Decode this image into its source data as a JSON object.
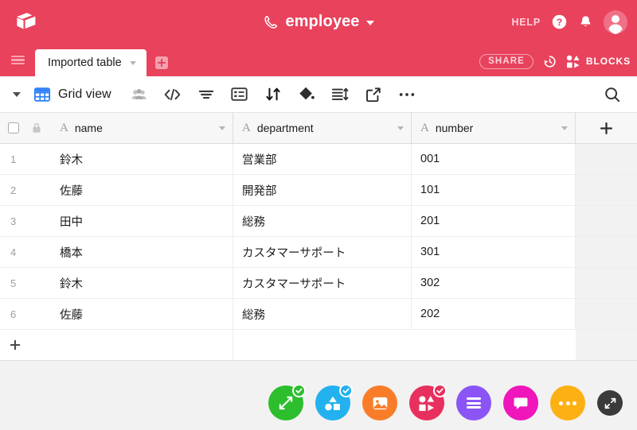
{
  "brand": {
    "logo_icon": "airtable-cube-logo",
    "bar_color": "#e8425c"
  },
  "header": {
    "base_icon": "phone-icon",
    "base_name": "employee",
    "base_caret_icon": "chevron-down-icon",
    "help_label": "HELP",
    "help_icon": "question-circle-icon",
    "notification_icon": "bell-icon",
    "avatar_icon": "user-avatar"
  },
  "tabbar": {
    "menu_icon": "hamburger-menu-icon",
    "tabs": [
      {
        "label": "Imported table",
        "caret_icon": "chevron-down-icon",
        "active": true
      }
    ],
    "add_table_icon": "plus-icon",
    "share_label": "SHARE",
    "history_icon": "history-clock-icon",
    "blocks_icon": "blocks-icon",
    "blocks_label": "BLOCKS"
  },
  "toolbar": {
    "view_caret_icon": "chevron-down-icon",
    "view_type_icon": "grid-view-icon",
    "view_name": "Grid view",
    "buttons": [
      {
        "name": "collaborators-icon",
        "label": ""
      },
      {
        "name": "hide-fields-icon",
        "label": ""
      },
      {
        "name": "filter-icon",
        "label": ""
      },
      {
        "name": "group-icon",
        "label": ""
      },
      {
        "name": "sort-icon",
        "label": ""
      },
      {
        "name": "color-fill-icon",
        "label": ""
      },
      {
        "name": "row-height-icon",
        "label": ""
      },
      {
        "name": "share-view-icon",
        "label": ""
      },
      {
        "name": "more-options-icon",
        "label": ""
      }
    ],
    "search_icon": "search-icon"
  },
  "grid": {
    "select_all_checkbox": false,
    "lock_icon": "lock-icon",
    "add_field_icon": "plus-icon",
    "add_row_icon": "plus-icon",
    "columns": [
      {
        "label": "name",
        "type_icon": "text-type-icon",
        "caret_icon": "chevron-down-icon"
      },
      {
        "label": "department",
        "type_icon": "text-type-icon",
        "caret_icon": "chevron-down-icon"
      },
      {
        "label": "number",
        "type_icon": "text-type-icon",
        "caret_icon": "chevron-down-icon"
      }
    ],
    "rows": [
      {
        "num": "1",
        "name": "鈴木",
        "department": "営業部",
        "number": "001"
      },
      {
        "num": "2",
        "name": "佐藤",
        "department": "開発部",
        "number": "101"
      },
      {
        "num": "3",
        "name": "田中",
        "department": "総務",
        "number": "201"
      },
      {
        "num": "4",
        "name": "橋本",
        "department": "カスタマーサポート",
        "number": "301"
      },
      {
        "num": "5",
        "name": "鈴木",
        "department": "カスタマーサポート",
        "number": "302"
      },
      {
        "num": "6",
        "name": "佐藤",
        "department": "総務",
        "number": "202"
      }
    ]
  },
  "fab_bar": {
    "buttons": [
      {
        "name": "expand-record-fab",
        "icon": "diagonal-arrows-icon",
        "color": "#2dbe2d",
        "badge": true
      },
      {
        "name": "shapes-fab",
        "icon": "shapes-icon",
        "color": "#23b1ef",
        "badge": true
      },
      {
        "name": "image-fab",
        "icon": "image-icon",
        "color": "#f97d28",
        "badge": false
      },
      {
        "name": "blocks-fab",
        "icon": "blocks-icon",
        "color": "#e8305e",
        "badge": true
      },
      {
        "name": "list-fab",
        "icon": "list-lines-icon",
        "color": "#8b55f6",
        "badge": false
      },
      {
        "name": "comment-fab",
        "icon": "chat-bubble-icon",
        "color": "#ef16bb",
        "badge": false
      },
      {
        "name": "more-fab",
        "icon": "ellipsis-icon",
        "color": "#fcb014",
        "badge": false
      },
      {
        "name": "collapse-fab",
        "icon": "collapse-arrows-icon",
        "color": "#3a3a3a",
        "badge": false
      }
    ]
  }
}
